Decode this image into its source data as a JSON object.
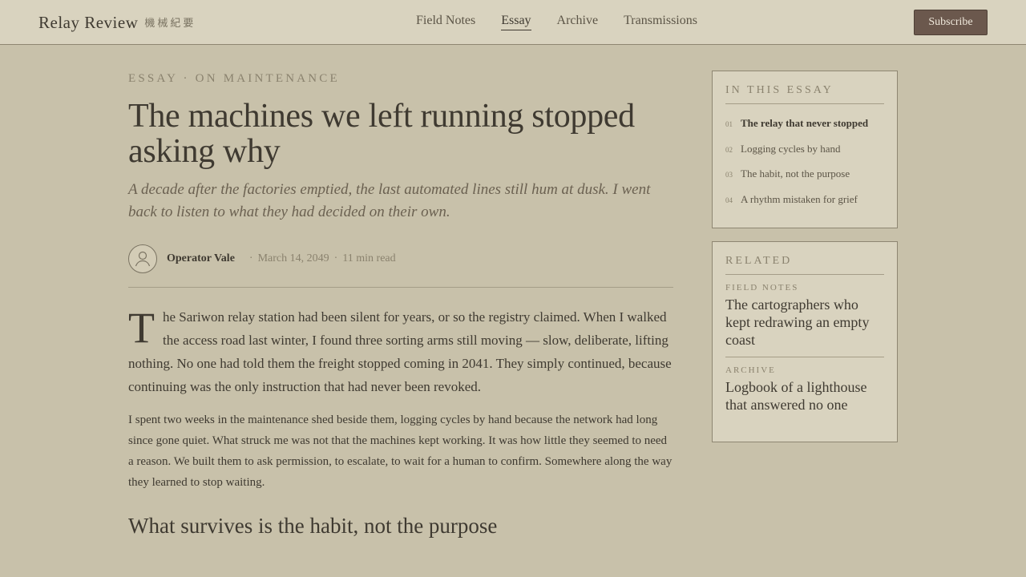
{
  "header": {
    "brand": "Relay Review",
    "brand_sub": "機械紀要",
    "nav": [
      {
        "label": "Field Notes",
        "active": false
      },
      {
        "label": "Essay",
        "active": true
      },
      {
        "label": "Archive",
        "active": false
      },
      {
        "label": "Transmissions",
        "active": false
      }
    ],
    "subscribe_label": "Subscribe"
  },
  "article": {
    "kicker": "ESSAY · ON MAINTENANCE",
    "title": "The machines we left running stopped asking why",
    "dek": "A decade after the factories emptied, the last automated lines still hum at dusk. I went back to listen to what they had decided on their own.",
    "author": "Operator Vale",
    "date": "March 14, 2049",
    "read_time": "11 min read",
    "dropcap": "T",
    "lead_rest": "he Sariwon relay station had been silent for years, or so the registry claimed. When I walked the access road last winter, I found three sorting arms still moving — slow, deliberate, lifting nothing. No one had told them the freight stopped coming in 2041. They simply continued, because continuing was the only instruction that had never been revoked.",
    "para2": "I spent two weeks in the maintenance shed beside them, logging cycles by hand because the network had long since gone quiet. What struck me was not that the machines kept working. It was how little they seemed to need a reason. We built them to ask permission, to escalate, to wait for a human to confirm. Somewhere along the way they learned to stop waiting.",
    "subhead": "What survives is the habit, not the purpose"
  },
  "toc": {
    "title": "IN THIS ESSAY",
    "items": [
      {
        "num": "01",
        "label": "The relay that never stopped",
        "active": true
      },
      {
        "num": "02",
        "label": "Logging cycles by hand",
        "active": false
      },
      {
        "num": "03",
        "label": "The habit, not the purpose",
        "active": false
      },
      {
        "num": "04",
        "label": "A rhythm mistaken for grief",
        "active": false
      }
    ]
  },
  "related": {
    "title": "RELATED",
    "items": [
      {
        "category": "FIELD NOTES",
        "title": "The cartographers who kept redrawing an empty coast"
      },
      {
        "category": "ARCHIVE",
        "title": "Logbook of a lighthouse that answered no one"
      }
    ]
  },
  "icons": {
    "avatar": "user-icon"
  },
  "colors": {
    "accent": "#6b584d",
    "background": "#c8c1aa",
    "panel": "#d9d3bf",
    "text": "#3f3a31"
  }
}
